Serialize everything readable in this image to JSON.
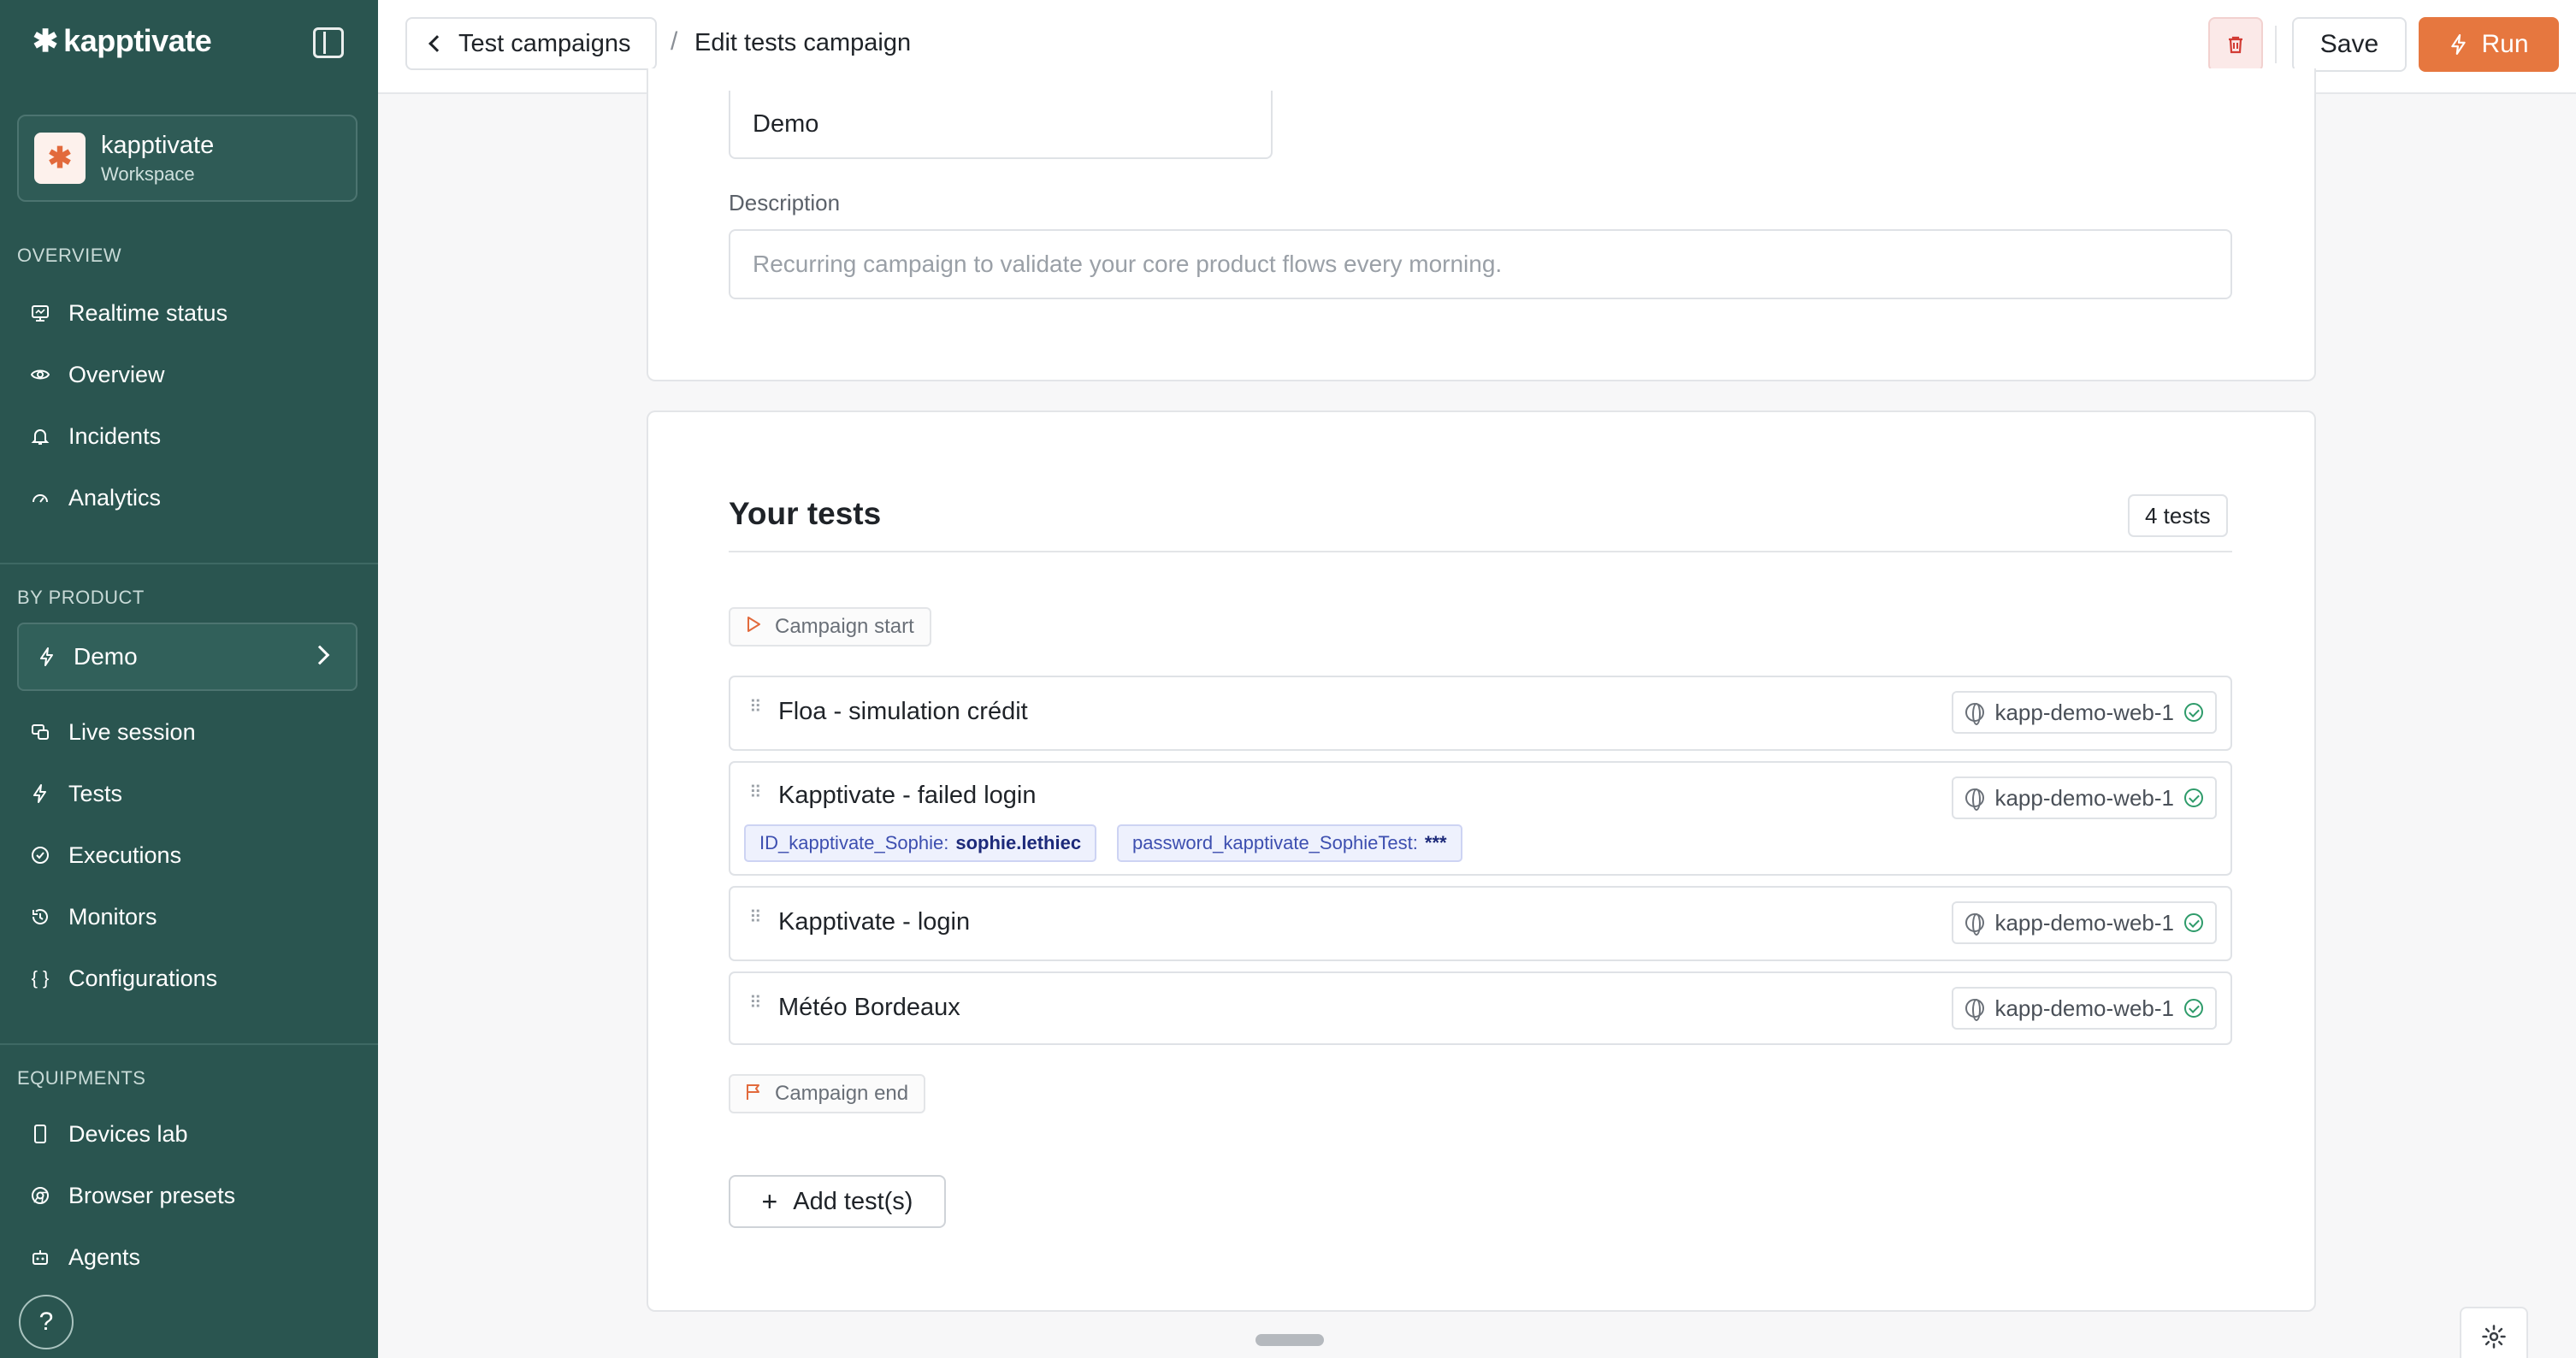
{
  "app": {
    "brand_mark": "✱",
    "brand_name": "kapptivate"
  },
  "workspace": {
    "logo": "✱",
    "name": "kapptivate",
    "subtitle": "Workspace"
  },
  "sidebar": {
    "overview_label": "OVERVIEW",
    "overview_items": [
      {
        "label": "Realtime status",
        "icon": "monitor-icon"
      },
      {
        "label": "Overview",
        "icon": "eye-icon"
      },
      {
        "label": "Incidents",
        "icon": "bell-icon"
      },
      {
        "label": "Analytics",
        "icon": "gauge-icon"
      }
    ],
    "product_label": "BY PRODUCT",
    "product_select": {
      "label": "Demo",
      "icon": "bolt-icon"
    },
    "product_items": [
      {
        "label": "Live session",
        "icon": "sessions-icon"
      },
      {
        "label": "Tests",
        "icon": "bolt-icon"
      },
      {
        "label": "Executions",
        "icon": "check-circle-icon"
      },
      {
        "label": "Monitors",
        "icon": "history-icon"
      },
      {
        "label": "Configurations",
        "icon": "braces-icon"
      }
    ],
    "equipments_label": "EQUIPMENTS",
    "equipment_items": [
      {
        "label": "Devices lab",
        "icon": "phone-icon"
      },
      {
        "label": "Browser presets",
        "icon": "chrome-icon"
      },
      {
        "label": "Agents",
        "icon": "robot-icon"
      }
    ],
    "help_label": "?"
  },
  "header": {
    "back_label": "Test campaigns",
    "separator": "/",
    "current": "Edit tests campaign",
    "save_label": "Save",
    "run_label": "Run"
  },
  "form": {
    "name_value": "Demo",
    "description_label": "Description",
    "description_placeholder": "Recurring campaign to validate your core product flows every morning."
  },
  "tests": {
    "title": "Your tests",
    "count": "4 tests",
    "start_label": "Campaign start",
    "end_label": "Campaign end",
    "add_label": "Add test(s)",
    "items": [
      {
        "name": "Floa - simulation crédit",
        "agent": "kapp-demo-web-1"
      },
      {
        "name": "Kapptivate - failed login",
        "agent": "kapp-demo-web-1",
        "vars": [
          {
            "key": "ID_kapptivate_Sophie:",
            "value": "sophie.lethiec"
          },
          {
            "key": "password_kapptivate_SophieTest:",
            "value": "***"
          }
        ]
      },
      {
        "name": "Kapptivate - login",
        "agent": "kapp-demo-web-1"
      },
      {
        "name": "Météo Bordeaux",
        "agent": "kapp-demo-web-1"
      }
    ]
  },
  "colors": {
    "sidebar": "#2a5550",
    "accent": "#e6773f",
    "success": "#2e9b6a"
  }
}
